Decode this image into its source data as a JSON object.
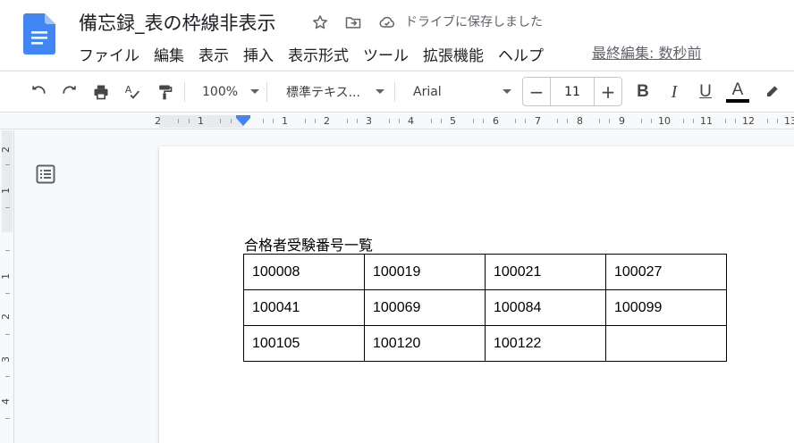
{
  "header": {
    "title": "備忘録_表の枠線非表示",
    "save_status": "ドライブに保存しました",
    "last_edit": "最終編集: 数秒前",
    "icons": [
      "docs-logo-icon",
      "star-icon",
      "move-folder-icon",
      "cloud-done-icon"
    ]
  },
  "menu": {
    "items": [
      {
        "label": "ファイル"
      },
      {
        "label": "編集"
      },
      {
        "label": "表示"
      },
      {
        "label": "挿入"
      },
      {
        "label": "表示形式"
      },
      {
        "label": "ツール"
      },
      {
        "label": "拡張機能"
      },
      {
        "label": "ヘルプ"
      }
    ]
  },
  "toolbar": {
    "zoom": "100%",
    "style": "標準テキス...",
    "font": "Arial",
    "font_size": "11",
    "minus": "−",
    "plus": "+",
    "icons": [
      "undo-icon",
      "redo-icon",
      "print-icon",
      "spellcheck-icon",
      "paint-format-icon",
      "bold-icon",
      "italic-icon",
      "underline-icon",
      "text-color-icon",
      "highlight-icon"
    ],
    "text_color": "#000000"
  },
  "ruler": {
    "labels": [
      "2",
      "1",
      "1",
      "2",
      "3",
      "4",
      "5",
      "6",
      "7",
      "8",
      "9",
      "10",
      "11",
      "12",
      "13"
    ]
  },
  "vruler": {
    "labels": [
      "2",
      "1",
      "1",
      "2",
      "3",
      "4"
    ]
  },
  "document": {
    "heading": "合格者受験番号一覧",
    "table": {
      "rows": [
        [
          "100008",
          "100019",
          "100021",
          "100027"
        ],
        [
          "100041",
          "100069",
          "100084",
          "100099"
        ],
        [
          "100105",
          "100120",
          "100122",
          ""
        ]
      ]
    }
  },
  "colors": {
    "accent": "#4285f4",
    "docs_blue": "#4285f4"
  }
}
